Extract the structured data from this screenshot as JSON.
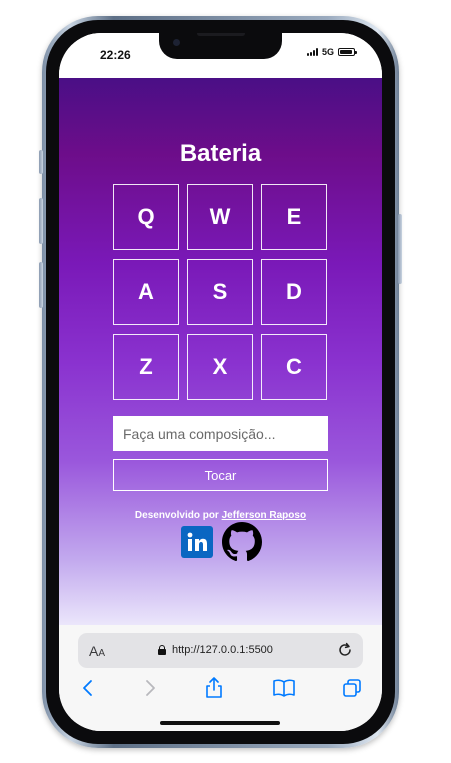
{
  "status_bar": {
    "time": "22:26",
    "network": "5G",
    "battery_level": 0.9
  },
  "app": {
    "title": "Bateria",
    "pads": [
      "Q",
      "W",
      "E",
      "A",
      "S",
      "D",
      "Z",
      "X",
      "C"
    ],
    "composition_input": {
      "value": "",
      "placeholder": "Faça uma composição..."
    },
    "play_button": "Tocar",
    "credits_prefix": "Desenvolvido por",
    "developer_name": "Jefferson Raposo",
    "socials": [
      "linkedin-icon",
      "github-icon"
    ]
  },
  "browser": {
    "text_size_label": "A",
    "text_size_label_small": "A",
    "url": "http://127.0.0.1:5500",
    "toolbar": [
      "back-icon",
      "forward-icon",
      "share-icon",
      "bookmarks-icon",
      "tabs-icon"
    ]
  },
  "colors": {
    "accent": "#007aff",
    "linkedin": "#0a66c2",
    "gradient_top": "#4a0f86",
    "gradient_mid": "#7a19b8"
  }
}
